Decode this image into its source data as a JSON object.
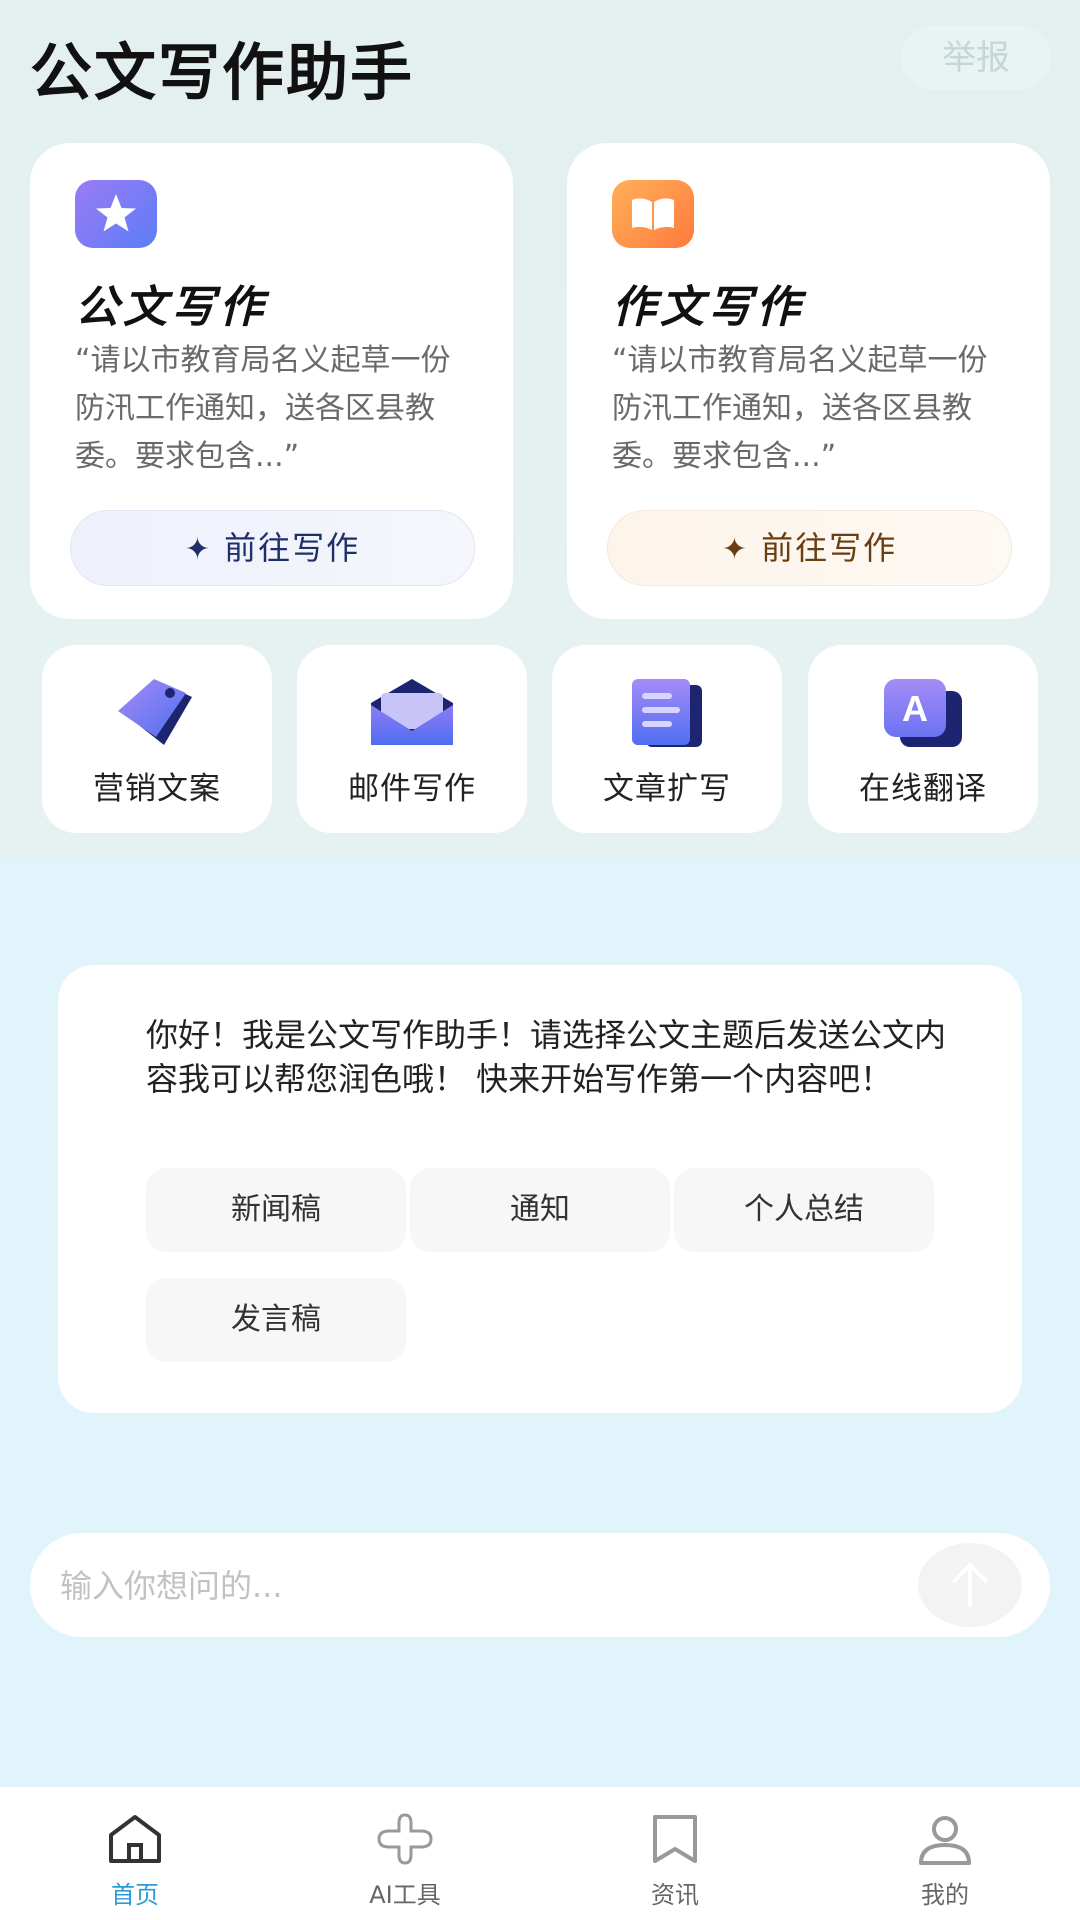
{
  "header": {
    "title": "公文写作助手",
    "report_label": "举报"
  },
  "cards": [
    {
      "title": "公文写作",
      "desc": "“请以市教育局名义起草一份防汛工作通知，送各区县教委。要求包含...”",
      "button": "前往写作"
    },
    {
      "title": "作文写作",
      "desc": "“请以市教育局名义起草一份防汛工作通知，送各区县教委。要求包含...”",
      "button": "前往写作"
    }
  ],
  "tools": [
    {
      "label": "营销文案",
      "icon": "tag-icon"
    },
    {
      "label": "邮件写作",
      "icon": "mail-icon"
    },
    {
      "label": "文章扩写",
      "icon": "document-icon"
    },
    {
      "label": "在线翻译",
      "icon": "translate-icon"
    }
  ],
  "chat": {
    "message": "你好！我是公文写作助手！请选择公文主题后发送公文内容我可以帮您润色哦！ 快来开始写作第一个内容吧！",
    "topics": [
      "新闻稿",
      "通知",
      "个人总结",
      "发言稿"
    ]
  },
  "input": {
    "placeholder": "输入你想问的..."
  },
  "tabs": [
    {
      "label": "首页",
      "active": true
    },
    {
      "label": "AI工具",
      "active": false
    },
    {
      "label": "资讯",
      "active": false
    },
    {
      "label": "我的",
      "active": false
    }
  ],
  "colors": {
    "accent": "#2f9bd6",
    "inactive": "#666666",
    "card_blue_text": "#1f2f6a",
    "card_orange_text": "#6a3d12"
  }
}
